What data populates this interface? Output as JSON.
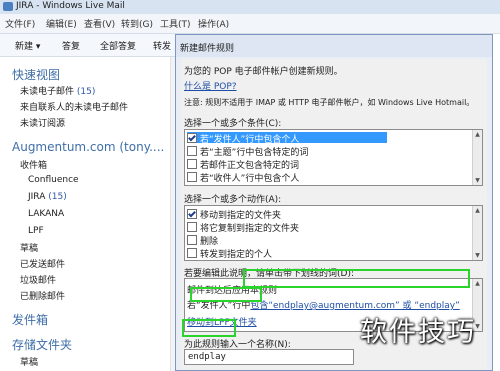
{
  "window": {
    "title": "JIRA - Windows Live Mail",
    "menu": [
      "文件(F)",
      "编辑(E)",
      "查看(V)",
      "转到(G)",
      "工具(T)",
      "操作(A)"
    ]
  },
  "toolbar": {
    "new": "新建 ▾",
    "reply": "答复",
    "reply_all": "全部答复",
    "forward": "转发"
  },
  "sidebar": {
    "quick_views": "快速视图",
    "unread_mail": "未读电子邮件",
    "unread_count": "(15)",
    "unread_contacts": "来自联系人的未读电子邮件",
    "unread_feeds": "未读订阅源",
    "account": "Augmentum.com (tony....",
    "inbox": "收件箱",
    "confluence": "Confluence",
    "jira": "JIRA",
    "jira_count": "(15)",
    "lakana": "LAKANA",
    "lpf": "LPF",
    "drafts": "草稿",
    "sent": "已发送邮件",
    "junk": "垃圾邮件",
    "deleted": "已删除邮件",
    "outbox": "发件箱",
    "storage": "存储文件夹",
    "drafts2": "草稿"
  },
  "dialog": {
    "title": "新建邮件规则",
    "intro": "为您的 POP 电子邮件帐户创建新规则。",
    "what_pop": "什么是 POP?",
    "note": "注意: 规则不适用于 IMAP 或 HTTP 电子邮件帐户，如 Windows Live Hotmail。",
    "conditions_label": "选择一个或多个条件(C):",
    "conditions": [
      {
        "text": "若“发件人”行中包含个人",
        "checked": true
      },
      {
        "text": "若“主题”行中包含特定的词",
        "checked": false
      },
      {
        "text": "若邮件正文包含特定的词",
        "checked": false
      },
      {
        "text": "若“收件人”行中包含个人",
        "checked": false
      }
    ],
    "actions_label": "选择一个或多个动作(A):",
    "actions": [
      {
        "text": "移动到指定的文件夹",
        "checked": true
      },
      {
        "text": "将它复制到指定的文件夹",
        "checked": false
      },
      {
        "text": "删除",
        "checked": false
      },
      {
        "text": "转发到指定的个人",
        "checked": false
      }
    ],
    "desc_label": "若要编辑此说明，请单击带下划线的词(D):",
    "desc_line1": "邮件到达后应用本规则",
    "desc_line2_prefix": "若“发件人”",
    "desc_line2_mid": "行中",
    "desc_line2_link": "包含“endplay@augmentum.com” 或 “endplay”",
    "desc_line3": "移动到LPF文件夹",
    "name_label": "为此规则输入一个名称(N):",
    "name_value": "endplay"
  },
  "watermark": "软件技巧"
}
